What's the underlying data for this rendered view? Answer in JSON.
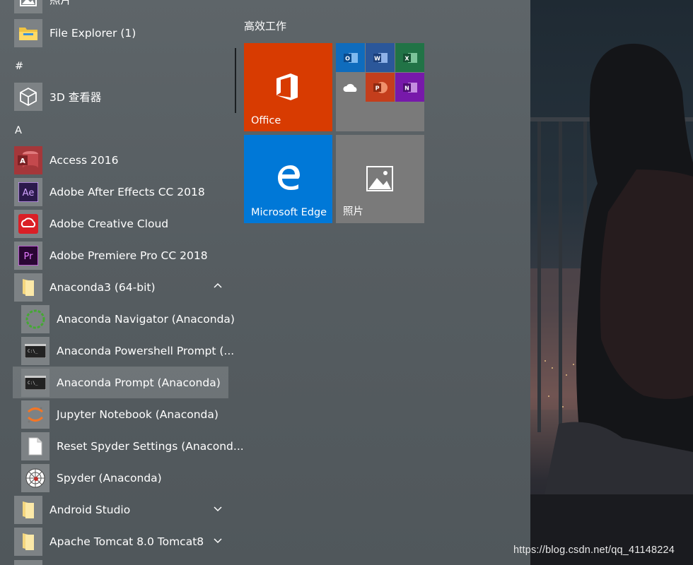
{
  "app_list": {
    "top_partial": "照片",
    "file_explorer": "File Explorer (1)",
    "section_hash": "#",
    "viewer_3d": "3D 查看器",
    "section_a": "A",
    "access": "Access 2016",
    "after_effects": "Adobe After Effects CC 2018",
    "creative_cloud": "Adobe Creative Cloud",
    "premiere": "Adobe Premiere Pro CC 2018",
    "anaconda_folder": "Anaconda3 (64-bit)",
    "navigator": "Anaconda Navigator (Anaconda)",
    "powershell": "Anaconda Powershell Prompt (...",
    "prompt": "Anaconda Prompt (Anaconda)",
    "jupyter": "Jupyter Notebook (Anaconda)",
    "reset_spyder": "Reset Spyder Settings (Anacond...",
    "spyder": "Spyder (Anaconda)",
    "android_studio": "Android Studio",
    "tomcat": "Apache Tomcat 8.0 Tomcat8"
  },
  "tiles": {
    "group_title": "高效工作",
    "office": "Office",
    "edge": "Microsoft Edge",
    "photos": "照片"
  },
  "colors": {
    "office_tile": "#d83b01",
    "edge_tile": "#0078d7",
    "grey_tile": "#7a7a7a",
    "access_red": "#a4373a",
    "ae_purple": "#2b1a4b",
    "cc_red": "#da1f26",
    "pr_purple": "#2a0634"
  },
  "watermark": "https://blog.csdn.net/qq_41148224"
}
